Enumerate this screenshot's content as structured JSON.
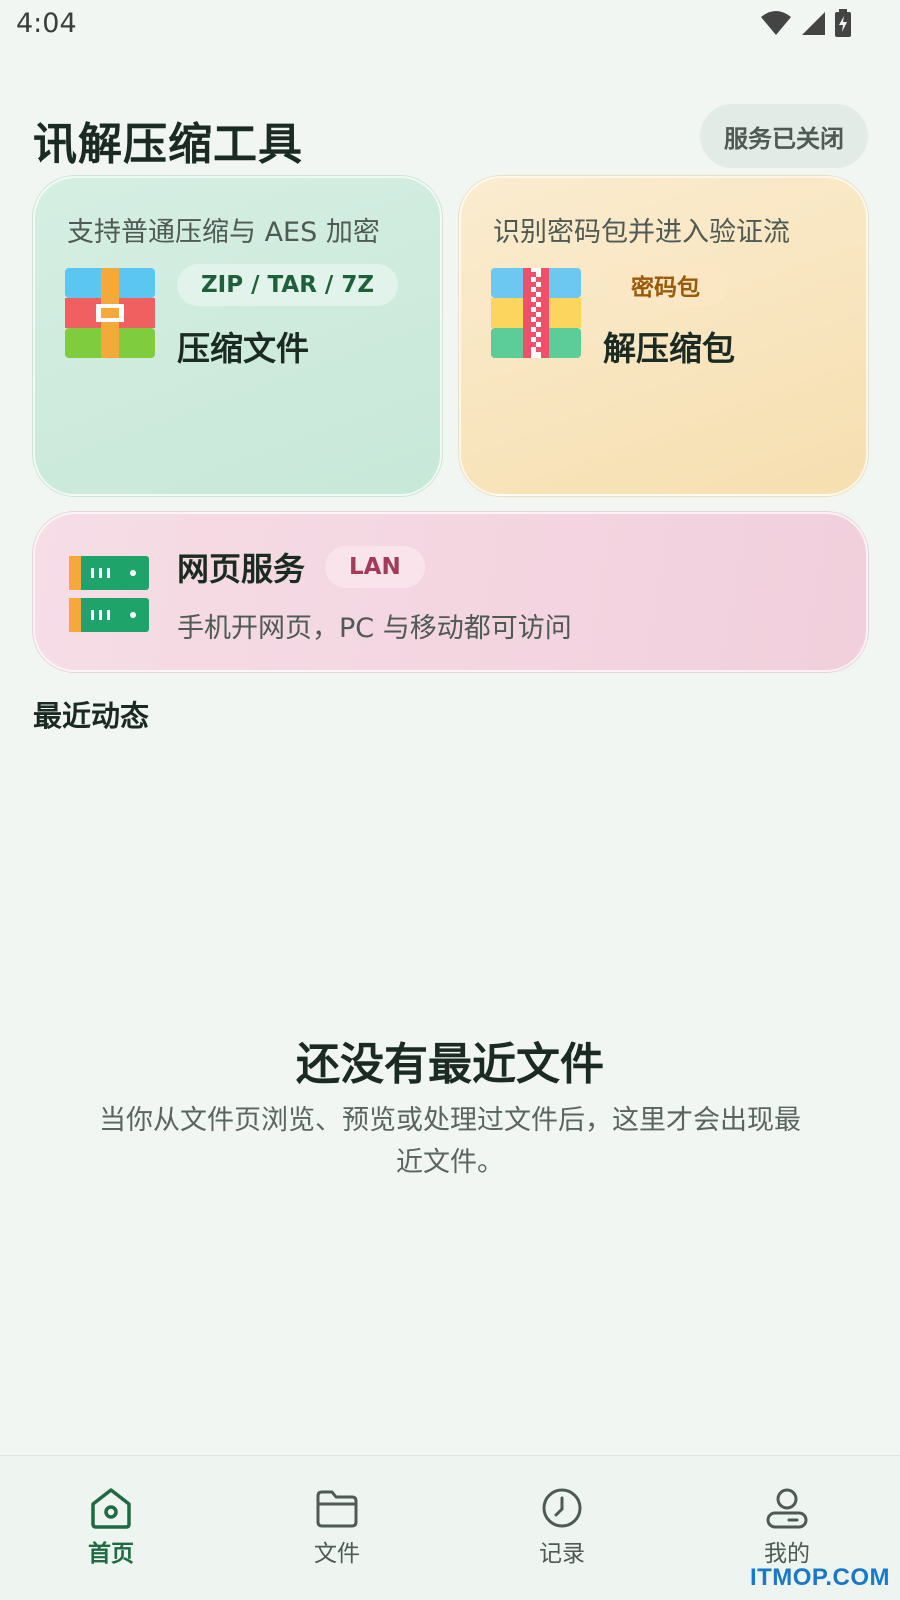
{
  "status_bar": {
    "time": "4:04"
  },
  "header": {
    "title": "讯解压缩工具",
    "service_status": "服务已关闭"
  },
  "cards": {
    "compress": {
      "description": "支持普通压缩与 AES 加密",
      "tag": "ZIP / TAR / 7Z",
      "name": "压缩文件"
    },
    "extract": {
      "description": "识别密码包并进入验证流",
      "tag": "密码包",
      "name": "解压缩包"
    },
    "web": {
      "name": "网页服务",
      "tag": "LAN",
      "description": "手机开网页，PC 与移动都可访问"
    }
  },
  "recent": {
    "section_title": "最近动态",
    "empty_title": "还没有最近文件",
    "empty_description": "当你从文件页浏览、预览或处理过文件后，这里才会出现最近文件。"
  },
  "bottom_nav": {
    "items": [
      {
        "label": "首页",
        "icon": "home-icon",
        "active": true
      },
      {
        "label": "文件",
        "icon": "folder-icon",
        "active": false
      },
      {
        "label": "记录",
        "icon": "clock-icon",
        "active": false
      },
      {
        "label": "我的",
        "icon": "user-icon",
        "active": false
      }
    ]
  },
  "watermark": "ITMOP.COM",
  "colors": {
    "accent": "#1f6a43",
    "compress_card": "#c7e8d8",
    "extract_card": "#f6dfb0",
    "web_card": "#f1cfdc"
  }
}
